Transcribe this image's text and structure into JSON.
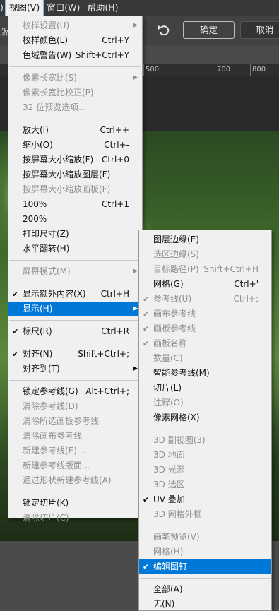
{
  "menubar": {
    "partial_label": ")",
    "items": [
      "视图(V)",
      "窗口(W)",
      "帮助(H)"
    ]
  },
  "optbar": {
    "left_text": "版",
    "confirm": "确定",
    "cancel": "取消"
  },
  "ruler": [
    "500",
    "700",
    "800"
  ],
  "view_menu": [
    {
      "label": "校样设置(U)",
      "shortcut": "",
      "disabled": true,
      "submenu": true
    },
    {
      "label": "校样颜色(L)",
      "shortcut": "Ctrl+Y"
    },
    {
      "label": "色域警告(W)",
      "shortcut": "Shift+Ctrl+Y"
    },
    {
      "sep": true
    },
    {
      "label": "像素长宽比(S)",
      "shortcut": "",
      "disabled": true,
      "submenu": true
    },
    {
      "label": "像素长宽比校正(P)",
      "shortcut": "",
      "disabled": true
    },
    {
      "label": "32 位预览选项...",
      "shortcut": "",
      "disabled": true
    },
    {
      "sep": true
    },
    {
      "label": "放大(I)",
      "shortcut": "Ctrl++"
    },
    {
      "label": "缩小(O)",
      "shortcut": "Ctrl+-"
    },
    {
      "label": "按屏幕大小缩放(F)",
      "shortcut": "Ctrl+0"
    },
    {
      "label": "按屏幕大小缩放图层(F)",
      "shortcut": ""
    },
    {
      "label": "按屏幕大小缩放画板(F)",
      "shortcut": "",
      "disabled": true
    },
    {
      "label": "100%",
      "shortcut": "Ctrl+1"
    },
    {
      "label": "200%",
      "shortcut": ""
    },
    {
      "label": "打印尺寸(Z)",
      "shortcut": ""
    },
    {
      "label": "水平翻转(H)",
      "shortcut": ""
    },
    {
      "sep": true
    },
    {
      "label": "屏幕模式(M)",
      "shortcut": "",
      "disabled": true,
      "submenu": true
    },
    {
      "sep": true
    },
    {
      "label": "显示额外内容(X)",
      "shortcut": "Ctrl+H",
      "checked": true
    },
    {
      "label": "显示(H)",
      "shortcut": "",
      "submenu": true,
      "highlight": true
    },
    {
      "sep": true
    },
    {
      "label": "标尺(R)",
      "shortcut": "Ctrl+R",
      "checked": true
    },
    {
      "sep": true
    },
    {
      "label": "对齐(N)",
      "shortcut": "Shift+Ctrl+;",
      "checked": true
    },
    {
      "label": "对齐到(T)",
      "shortcut": "",
      "submenu": true
    },
    {
      "sep": true
    },
    {
      "label": "锁定参考线(G)",
      "shortcut": "Alt+Ctrl+;"
    },
    {
      "label": "清除参考线(D)",
      "shortcut": "",
      "disabled": true
    },
    {
      "label": "清除所选画板参考线",
      "shortcut": "",
      "disabled": true
    },
    {
      "label": "清除画布参考线",
      "shortcut": "",
      "disabled": true
    },
    {
      "label": "新建参考线(E)...",
      "shortcut": "",
      "disabled": true
    },
    {
      "label": "新建参考线版面...",
      "shortcut": "",
      "disabled": true
    },
    {
      "label": "通过形状新建参考线(A)",
      "shortcut": "",
      "disabled": true
    },
    {
      "sep": true
    },
    {
      "label": "锁定切片(K)",
      "shortcut": ""
    },
    {
      "label": "清除切片(C)",
      "shortcut": "",
      "disabled": true
    }
  ],
  "show_menu": [
    {
      "label": "图层边缘(E)",
      "shortcut": ""
    },
    {
      "label": "选区边缘(S)",
      "shortcut": "",
      "disabled": true
    },
    {
      "label": "目标路径(P)",
      "shortcut": "Shift+Ctrl+H",
      "disabled": true
    },
    {
      "label": "网格(G)",
      "shortcut": "Ctrl+'"
    },
    {
      "label": "参考线(U)",
      "shortcut": "Ctrl+;",
      "disabled": true,
      "checked": true
    },
    {
      "label": "画布参考线",
      "shortcut": "",
      "disabled": true,
      "checked": true
    },
    {
      "label": "画板参考线",
      "shortcut": "",
      "disabled": true,
      "checked": true
    },
    {
      "label": "画板名称",
      "shortcut": "",
      "disabled": true,
      "checked": true
    },
    {
      "label": "数量(C)",
      "shortcut": "",
      "disabled": true
    },
    {
      "label": "智能参考线(M)",
      "shortcut": ""
    },
    {
      "label": "切片(L)",
      "shortcut": ""
    },
    {
      "label": "注释(O)",
      "shortcut": "",
      "disabled": true
    },
    {
      "label": "像素网格(X)",
      "shortcut": ""
    },
    {
      "sep": true
    },
    {
      "label": "3D 副视图(3)",
      "shortcut": "",
      "disabled": true
    },
    {
      "label": "3D 地面",
      "shortcut": "",
      "disabled": true
    },
    {
      "label": "3D 光源",
      "shortcut": "",
      "disabled": true
    },
    {
      "label": "3D 选区",
      "shortcut": "",
      "disabled": true
    },
    {
      "label": "UV 叠加",
      "shortcut": "",
      "checked": true
    },
    {
      "label": "3D 网格外框",
      "shortcut": "",
      "disabled": true
    },
    {
      "sep": true
    },
    {
      "label": "画笔预览(V)",
      "shortcut": "",
      "disabled": true
    },
    {
      "label": "网格(H)",
      "shortcut": "",
      "disabled": true
    },
    {
      "label": "编辑图钉",
      "shortcut": "",
      "checked": true,
      "highlight": true
    },
    {
      "sep": true
    },
    {
      "label": "全部(A)",
      "shortcut": ""
    },
    {
      "label": "无(N)",
      "shortcut": ""
    }
  ]
}
